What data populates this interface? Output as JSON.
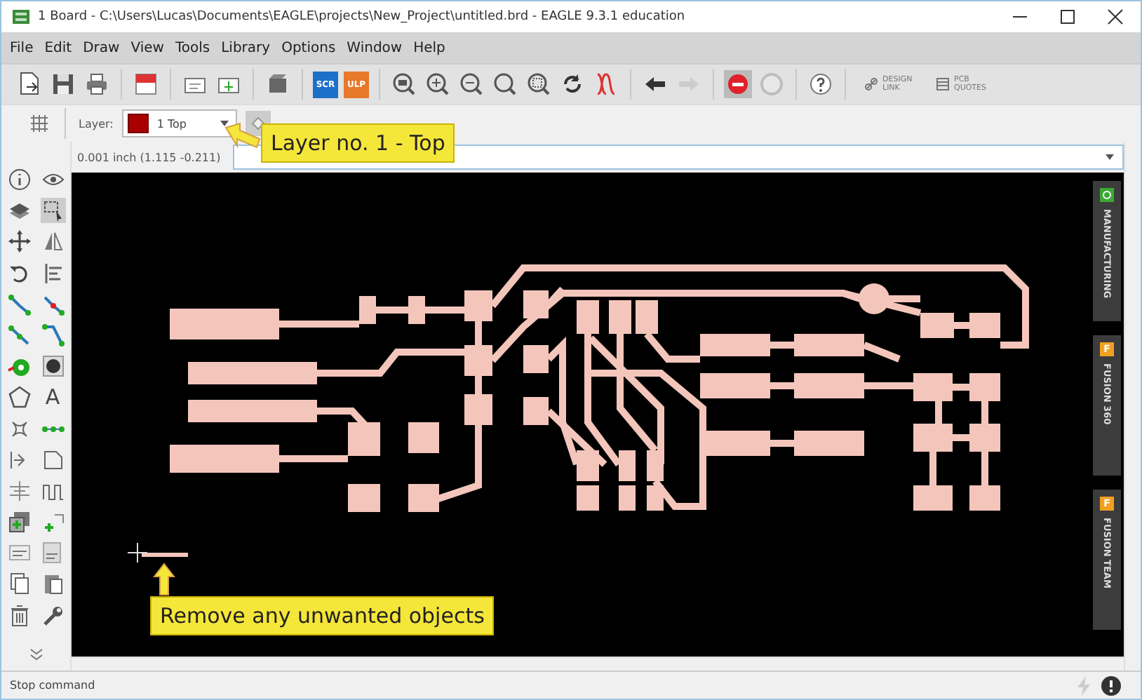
{
  "window": {
    "title": "1 Board - C:\\Users\\Lucas\\Documents\\EAGLE\\projects\\New_Project\\untitled.brd - EAGLE 9.3.1 education"
  },
  "menu": [
    "File",
    "Edit",
    "Draw",
    "View",
    "Tools",
    "Library",
    "Options",
    "Window",
    "Help"
  ],
  "toolbar": {
    "script_label": "SCR",
    "ulp_label": "ULP",
    "design_link": "DESIGN LINK",
    "pcb_quotes": "PCB QUOTES"
  },
  "layer_bar": {
    "label": "Layer:",
    "value": "1 Top"
  },
  "coordinates": "0.001 inch (1.115 -0.211)",
  "palette": {
    "text_tool": "A"
  },
  "side_panels": [
    {
      "kind": "manufacturing",
      "label": "MANUFACTURING"
    },
    {
      "kind": "fusion",
      "badge": "F",
      "label": "FUSION 360"
    },
    {
      "kind": "fusion",
      "badge": "F",
      "label": "FUSION TEAM"
    }
  ],
  "annotations": [
    {
      "kind": "left",
      "text": "Layer no. 1 - Top"
    },
    {
      "kind": "up",
      "text": "Remove any unwanted objects"
    }
  ],
  "status_bar": {
    "text": "Stop command"
  }
}
